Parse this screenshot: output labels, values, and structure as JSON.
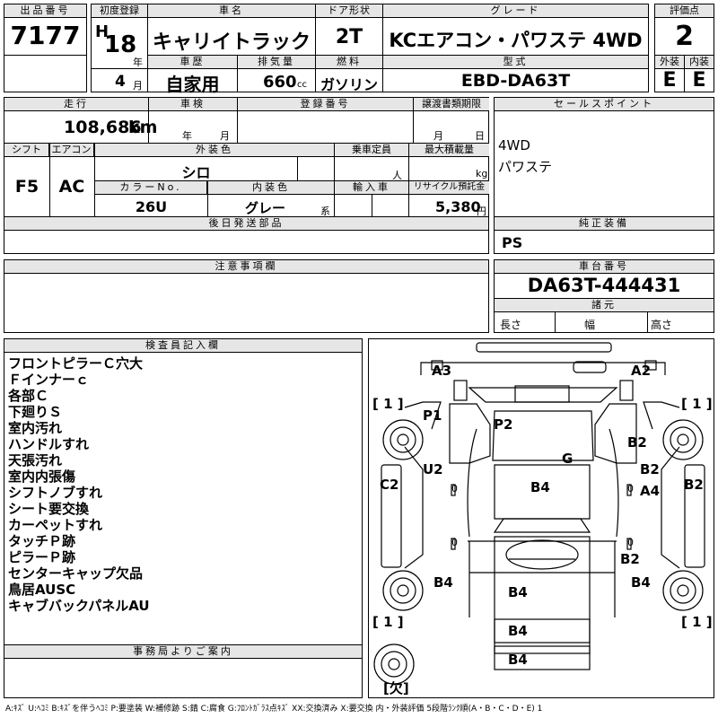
{
  "header": {
    "lot_number_label": "出品番号",
    "lot_number": "7177",
    "first_reg_label": "初度登録",
    "era": "H",
    "year": "18",
    "year_unit": "年",
    "month": "4",
    "month_unit": "月",
    "car_name_label": "車名",
    "car_name": "キャリイトラック",
    "door_label": "ドア形状",
    "door": "2T",
    "grade_label": "グレード",
    "grade": "KCエアコン・パワステ 4WD",
    "score_label": "評価点",
    "score": "2",
    "history_label": "車歴",
    "history": "自家用",
    "displacement_label": "排気量",
    "displacement": "660",
    "displacement_unit": "cc",
    "fuel_label": "燃料",
    "fuel": "ガソリン",
    "model_label": "型式",
    "model": "EBD-DA63T",
    "exterior_label": "外装",
    "exterior": "E",
    "interior_label": "内装",
    "interior": "E"
  },
  "details": {
    "mileage_label": "走行",
    "mileage": "108,686",
    "mileage_unit": "km",
    "inspection_label": "車検",
    "inspection_year_unit": "年",
    "inspection_month_unit": "月",
    "reg_no_label": "登録番号",
    "transfer_label": "譲渡書類期限",
    "transfer_month_unit": "月",
    "transfer_day_unit": "日",
    "shift_label": "シフト",
    "shift": "F5",
    "ac_label": "エアコン",
    "ac": "AC",
    "ext_color_label": "外装色",
    "ext_color": "シロ",
    "capacity_label": "乗車定員",
    "capacity_unit": "人",
    "max_load_label": "最大積載量",
    "max_load_unit": "kg",
    "color_no_label": "カラーNo.",
    "color_no": "26U",
    "int_color_label": "内装色",
    "int_color": "グレー",
    "int_color_suffix": "系",
    "import_label": "輸入車",
    "recycle_label": "リサイクル預託金",
    "recycle": "5,380",
    "recycle_unit": "円",
    "later_parts_label": "後日発送部品",
    "notes_label": "注意事項欄"
  },
  "sales": {
    "label": "セールスポイント",
    "lines": [
      "4WD",
      "パワステ"
    ]
  },
  "equipment": {
    "label": "純正装備",
    "value": "PS"
  },
  "chassis": {
    "label": "車台番号",
    "value": "DA63T-444431",
    "specs_label": "諸元",
    "length_label": "長さ",
    "width_label": "幅",
    "height_label": "高さ"
  },
  "inspector": {
    "label": "検査員記入欄",
    "lines": [
      "フロントピラーＣ穴大",
      "Ｆインナーｃ",
      "各部Ｃ",
      "下廻りＳ",
      "室内汚れ",
      "ハンドルすれ",
      "天張汚れ",
      "室内内張傷",
      "シフトノブすれ",
      "シート要交換",
      "カーペットすれ",
      "タッチＰ跡",
      "ピラーＰ跡",
      "センターキャップ欠品",
      "鳥居AUSC",
      "キャブバックパネルAU"
    ]
  },
  "office": {
    "label": "事務局よりご案内"
  },
  "diagram": {
    "marks": [
      "A3",
      "A2",
      "P1",
      "P2",
      "G",
      "U2",
      "B2",
      "B2",
      "C2",
      "B4",
      "A4",
      "B2",
      "B2",
      "B4",
      "B4",
      "B4",
      "B4",
      "B4"
    ],
    "brackets": [
      "[ 1 ]",
      "[ 1 ]",
      "[ 1 ]",
      "[ 1 ]"
    ],
    "missing": "[欠]",
    "zero": "0"
  },
  "legend": "A:ｷｽﾞ U:ﾍｺﾐ B:ｷｽﾞを伴うﾍｺﾐ P:要塗装 W:補修跡 S:錆 C:腐食 G:ﾌﾛﾝﾄｶﾞﾗｽ点ｷｽﾞ XX:交換済み X:要交換 内・外装評価 5段階ﾗﾝｸ順(A・B・C・D・E) 1"
}
